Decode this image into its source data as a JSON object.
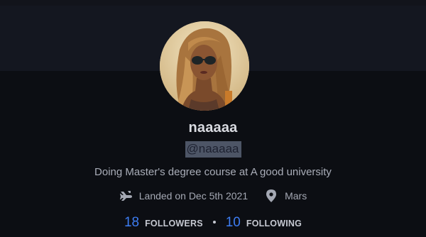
{
  "profile": {
    "name": "naaaaa",
    "handle": "@naaaaa",
    "bio": "Doing Master's degree course at A good university",
    "landed": "Landed on Dec 5th 2021",
    "location": "Mars"
  },
  "stats": {
    "followers_count": "18",
    "followers_label": "FOLLOWERS",
    "following_count": "10",
    "following_label": "FOLLOWING"
  },
  "icons": {
    "landed": "landing-icon",
    "location": "location-pin-icon"
  },
  "colors": {
    "accent": "#3d7df3",
    "background": "#0c0e13",
    "banner": "#141720"
  }
}
